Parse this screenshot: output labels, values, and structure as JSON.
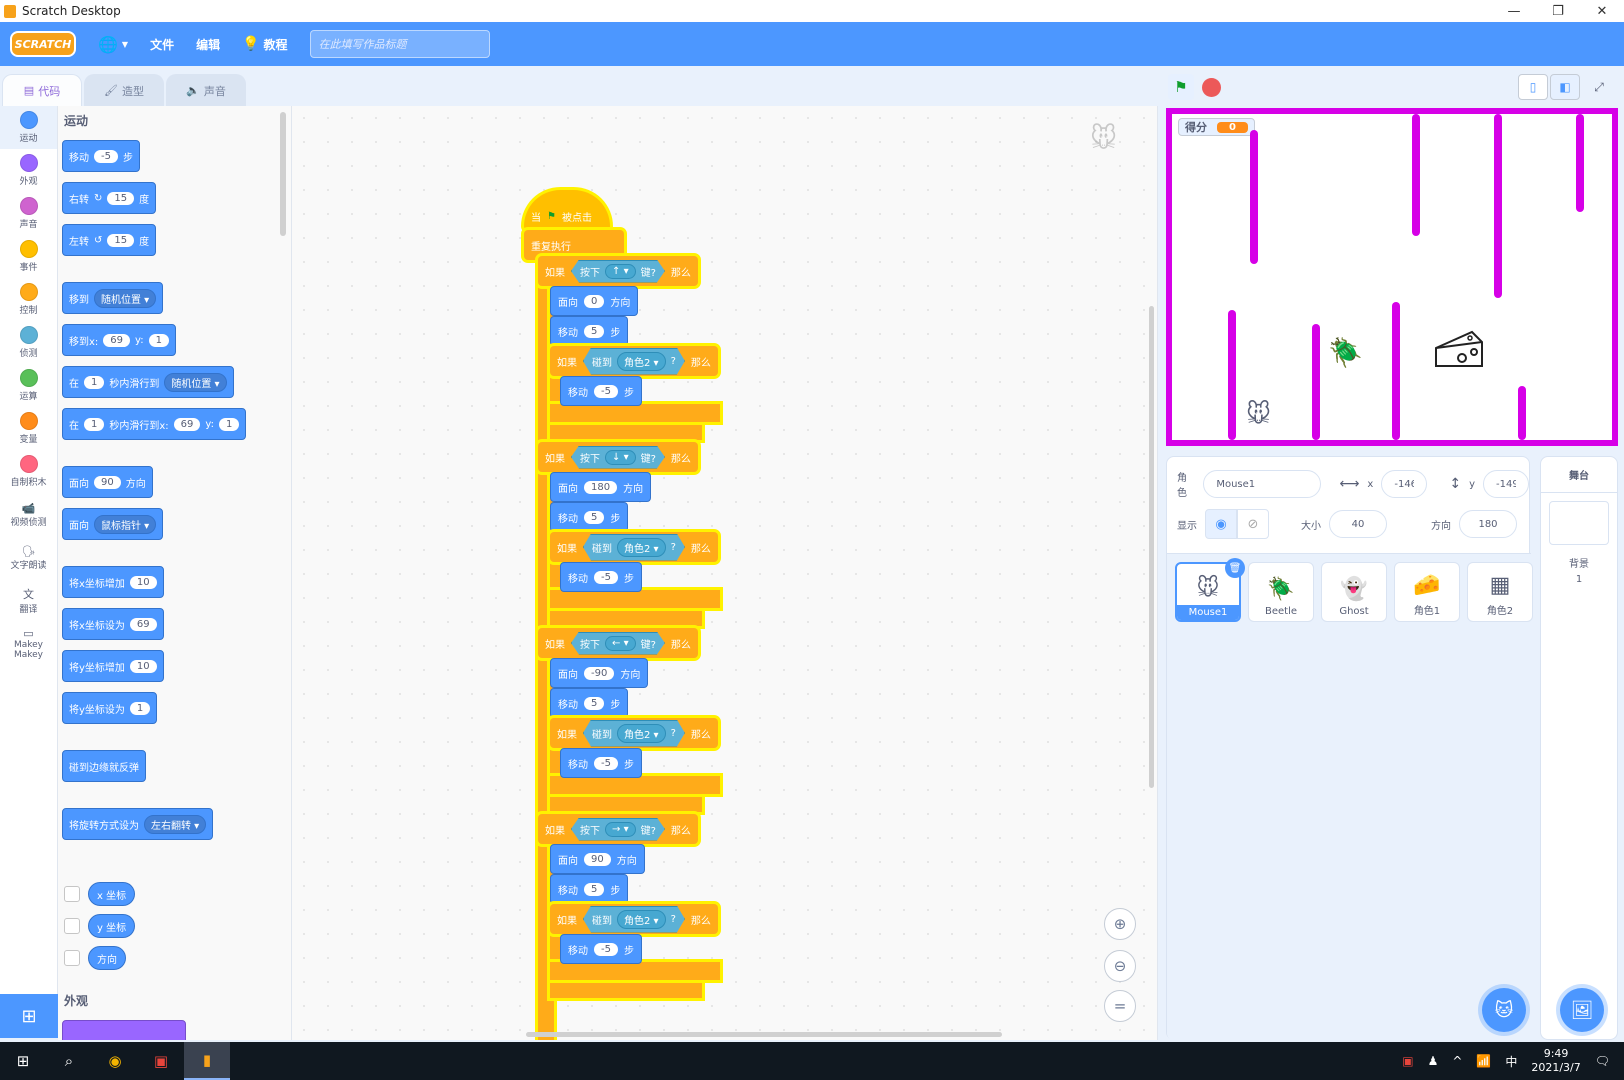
{
  "window": {
    "title": "Scratch Desktop",
    "minimize": "—",
    "restore": "❐",
    "close": "✕"
  },
  "menu": {
    "logo": "SCRATCH",
    "file": "文件",
    "edit": "编辑",
    "tutorials": "教程",
    "title_placeholder": "在此填写作品标题"
  },
  "tabs": {
    "code": "代码",
    "costumes": "造型",
    "sounds": "声音"
  },
  "categories": [
    {
      "label": "运动",
      "color": "#4c97ff"
    },
    {
      "label": "外观",
      "color": "#9966ff"
    },
    {
      "label": "声音",
      "color": "#cf63cf"
    },
    {
      "label": "事件",
      "color": "#ffbf00"
    },
    {
      "label": "控制",
      "color": "#ffab19"
    },
    {
      "label": "侦测",
      "color": "#5cb1d6"
    },
    {
      "label": "运算",
      "color": "#59c059"
    },
    {
      "label": "变量",
      "color": "#ff8c1a"
    },
    {
      "label": "自制积木",
      "color": "#ff6680"
    }
  ],
  "extensions": [
    {
      "label": "视频侦测",
      "icon": "video-sensing-icon"
    },
    {
      "label": "文字朗读",
      "icon": "text-to-speech-icon"
    },
    {
      "label": "翻译",
      "icon": "translate-icon"
    },
    {
      "label": "Makey Makey",
      "icon": "makey-makey-icon"
    }
  ],
  "palette": {
    "heading_motion": "运动",
    "heading_looks": "外观",
    "move": {
      "a": "移动",
      "v": "-5",
      "b": "步"
    },
    "turn_right": {
      "a": "右转",
      "v": "15",
      "b": "度"
    },
    "turn_left": {
      "a": "左转",
      "v": "15",
      "b": "度"
    },
    "goto": {
      "a": "移到",
      "d": "随机位置"
    },
    "goto_xy": {
      "a": "移到x:",
      "x": "69",
      "b": "y:",
      "y": "1"
    },
    "glide": {
      "a": "在",
      "v": "1",
      "b": "秒内滑行到",
      "d": "随机位置"
    },
    "glide_xy": {
      "a": "在",
      "v": "1",
      "b": "秒内滑行到x:",
      "x": "69",
      "c": "y:",
      "y": "1"
    },
    "point_dir": {
      "a": "面向",
      "v": "90",
      "b": "方向"
    },
    "point_towards": {
      "a": "面向",
      "d": "鼠标指针"
    },
    "change_x": {
      "a": "将x坐标增加",
      "v": "10"
    },
    "set_x": {
      "a": "将x坐标设为",
      "v": "69"
    },
    "change_y": {
      "a": "将y坐标增加",
      "v": "10"
    },
    "set_y": {
      "a": "将y坐标设为",
      "v": "1"
    },
    "bounce": "碰到边缘就反弹",
    "rotation": {
      "a": "将旋转方式设为",
      "d": "左右翻转"
    },
    "x_pos": "x 坐标",
    "y_pos": "y 坐标",
    "direction": "方向"
  },
  "script": {
    "hat": {
      "a": "当",
      "b": "被点击"
    },
    "forever": "重复执行",
    "if_label": "如果",
    "then_label": "那么",
    "key_pressed_a": "按下",
    "key_pressed_b": "键?",
    "touching": "碰到",
    "touching_target": "角色2",
    "touching_q": "?",
    "face": "面向",
    "dir": "方向",
    "move": "移动",
    "step": "步",
    "groups": [
      {
        "key": "↑",
        "dir": "0",
        "move": "5",
        "back": "-5"
      },
      {
        "key": "↓",
        "dir": "180",
        "move": "5",
        "back": "-5"
      },
      {
        "key": "←",
        "dir": "-90",
        "move": "5",
        "back": "-5"
      },
      {
        "key": "→",
        "dir": "90",
        "move": "5",
        "back": "-5"
      }
    ]
  },
  "stage": {
    "score_label": "得分",
    "score_value": "0"
  },
  "sprite_info": {
    "sprite_label": "角色",
    "sprite_name": "Mouse1",
    "x_label": "x",
    "x": "-146",
    "y_label": "y",
    "y": "-149",
    "show_label": "显示",
    "size_label": "大小",
    "size": "40",
    "direction_label": "方向",
    "direction": "180"
  },
  "sprites": [
    {
      "name": "Mouse1",
      "thumb": "🐭",
      "selected": true
    },
    {
      "name": "Beetle",
      "thumb": "🪲",
      "selected": false
    },
    {
      "name": "Ghost",
      "thumb": "👻",
      "selected": false
    },
    {
      "name": "角色1",
      "thumb": "🧀",
      "selected": false
    },
    {
      "name": "角色2",
      "thumb": "▦",
      "selected": false
    }
  ],
  "stage_selector": {
    "title": "舞台",
    "backdrop_label": "背景",
    "backdrop_count": "1"
  },
  "taskbar": {
    "time": "9:49",
    "date": "2021/3/7",
    "ime": "中"
  }
}
